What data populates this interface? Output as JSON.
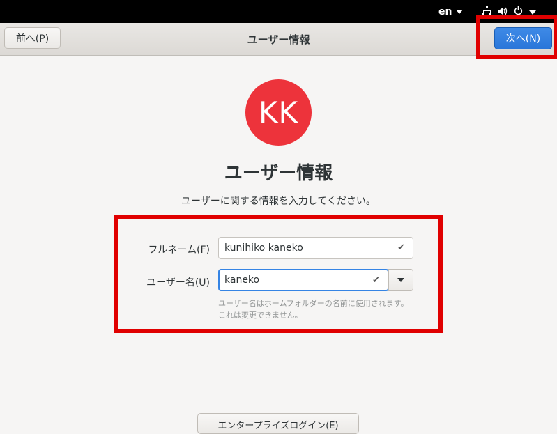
{
  "topbar": {
    "language": "en",
    "network_icon": "network-wired-icon",
    "volume_icon": "speaker-volume-icon",
    "power_icon": "power-icon"
  },
  "header": {
    "back_label": "前へ(P)",
    "title": "ユーザー情報",
    "next_label": "次へ(N)"
  },
  "avatar": {
    "initials": "KK",
    "color": "#ed333b"
  },
  "page": {
    "title": "ユーザー情報",
    "subtitle": "ユーザーに関する情報を入力してください。"
  },
  "form": {
    "fullname_label": "フルネーム(F)",
    "fullname_value": "kunihiko kaneko",
    "username_label": "ユーザー名(U)",
    "username_value": "kaneko",
    "hint": "ユーザー名はホームフォルダーの名前に使用されます。これは変更できません。"
  },
  "bottom": {
    "enterprise_label": "エンタープライズログイン(E)"
  },
  "colors": {
    "accent": "#3584e4",
    "highlight": "#e00000"
  }
}
